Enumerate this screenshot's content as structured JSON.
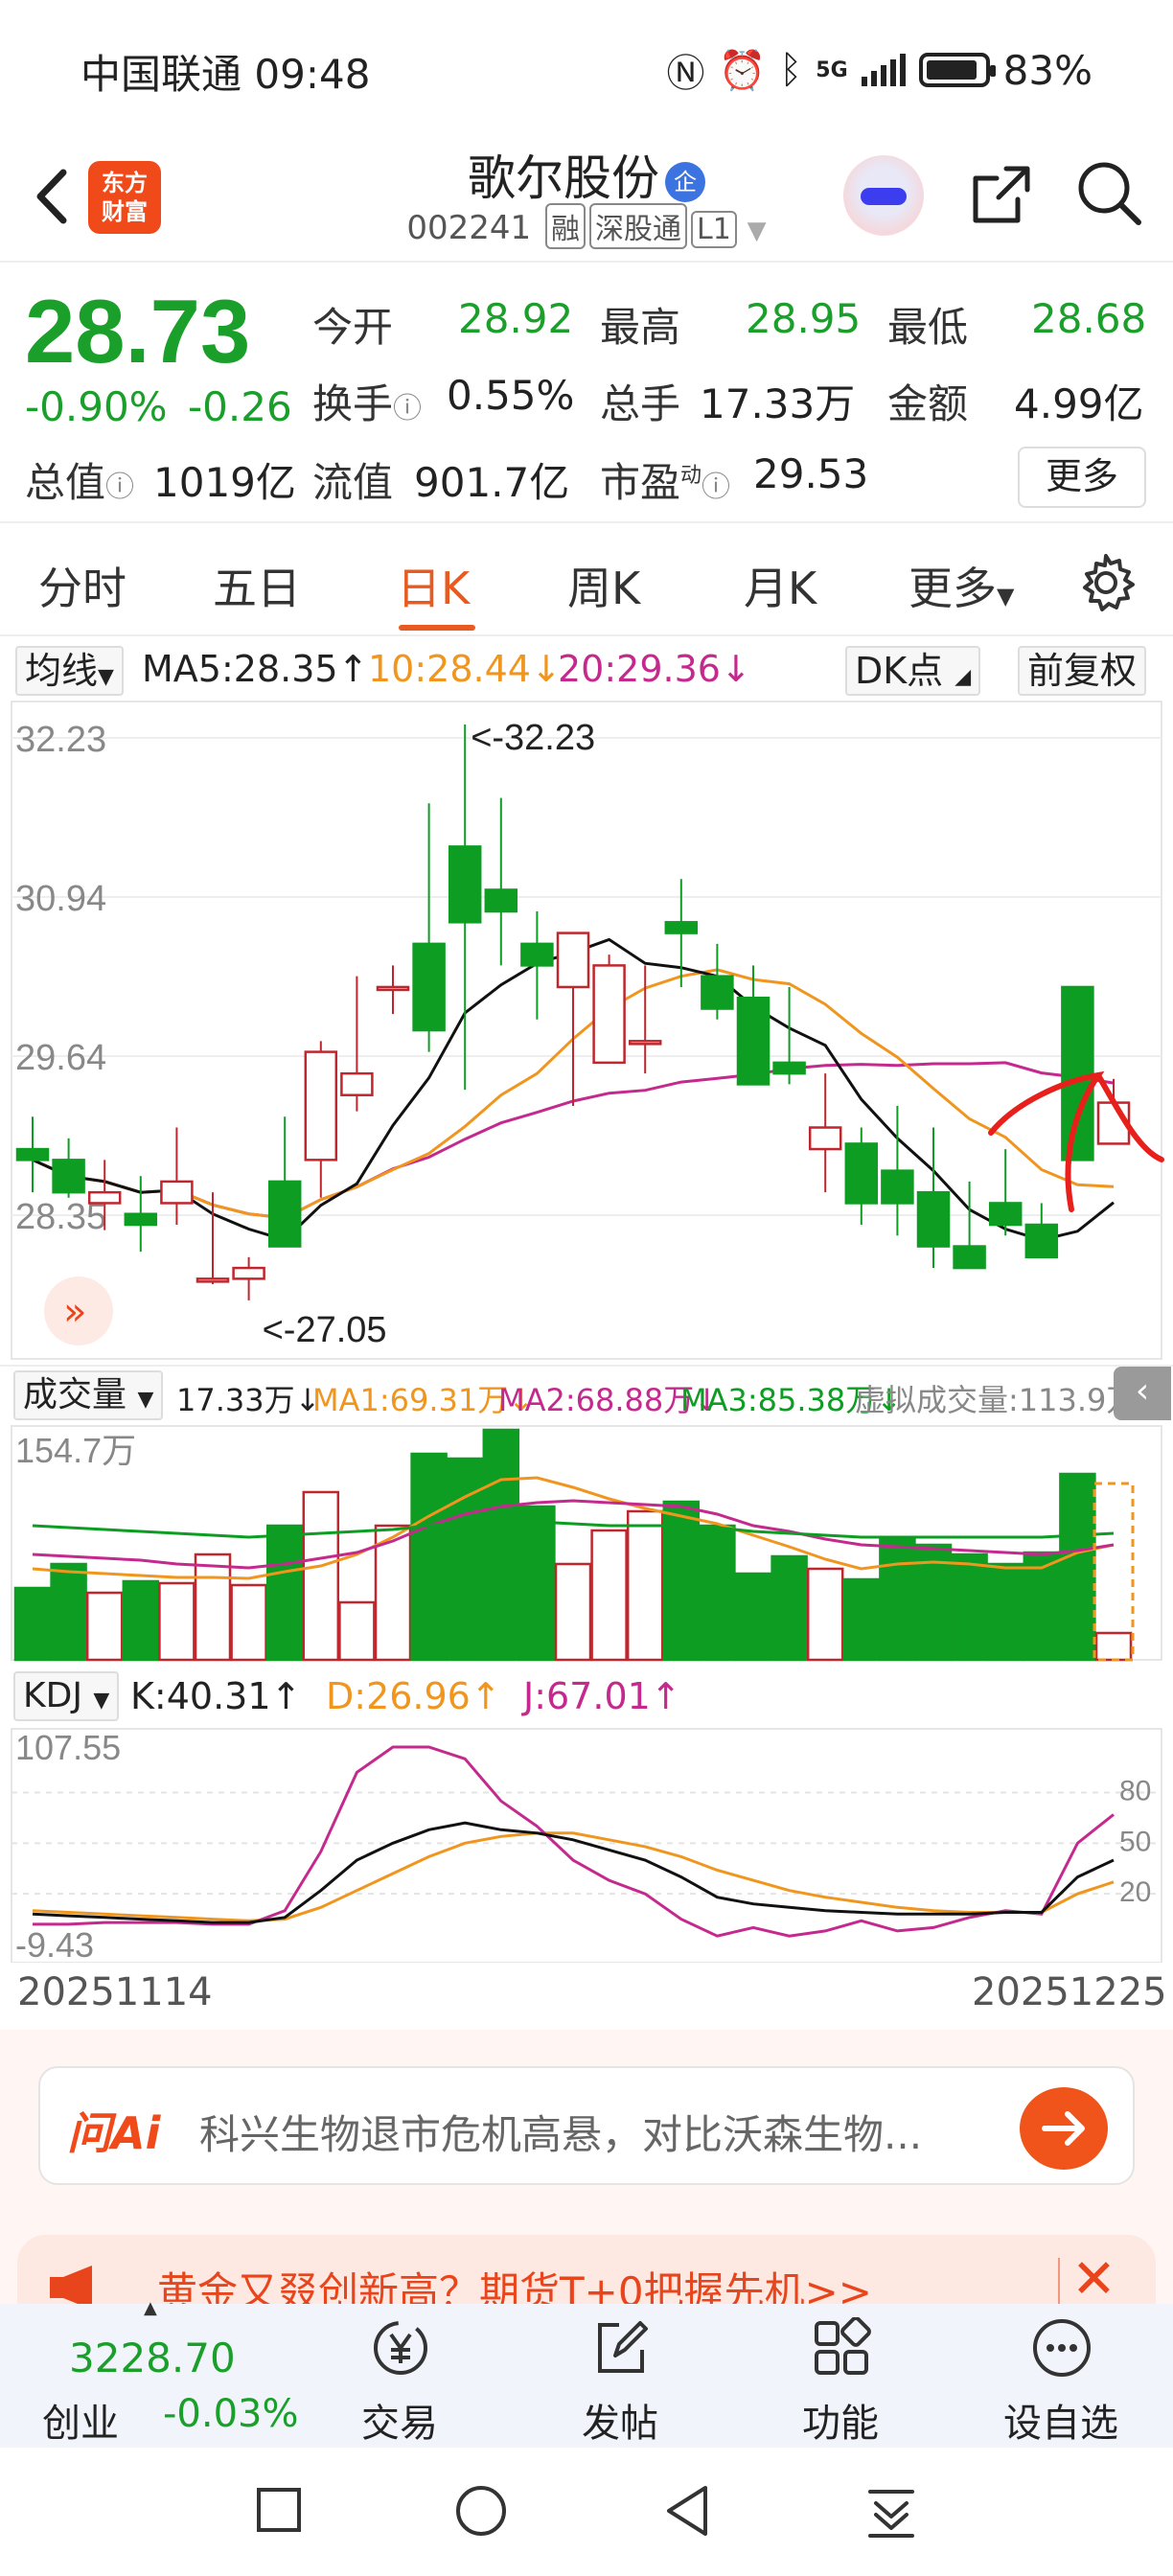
{
  "status_bar": {
    "carrier": "中国联通",
    "time": "09:48",
    "battery": "83%",
    "network": "5G"
  },
  "header": {
    "logo_text_line1": "东方",
    "logo_text_line2": "财富",
    "stock_name": "歌尔股份",
    "stock_badge": "企",
    "stock_code": "002241",
    "tag_margin": "融",
    "tag_connect": "深股通",
    "tag_level": "L1"
  },
  "quote": {
    "price": "28.73",
    "change_pct": "-0.90%",
    "change": "-0.26",
    "open_label": "今开",
    "open": "28.92",
    "high_label": "最高",
    "high": "28.95",
    "low_label": "最低",
    "low": "28.68",
    "turnover_label": "换手",
    "turnover": "0.55%",
    "volume_label": "总手",
    "volume": "17.33万",
    "amount_label": "金额",
    "amount": "4.99亿",
    "mcap_label": "总值",
    "mcap": "1019亿",
    "float_label": "流值",
    "float": "901.7亿",
    "pe_label": "市盈",
    "pe_sup": "动",
    "pe": "29.53",
    "more_label": "更多"
  },
  "tabs": [
    {
      "label": "分时"
    },
    {
      "label": "五日"
    },
    {
      "label": "日K",
      "active": true
    },
    {
      "label": "周K"
    },
    {
      "label": "月K"
    },
    {
      "label": "更多"
    }
  ],
  "ma_row": {
    "selector": "均线",
    "ma5": "MA5:28.35",
    "ma10": "10:28.44",
    "ma20": "20:29.36",
    "dk": "DK点",
    "adjust": "前复权"
  },
  "kline": {
    "y_labels": [
      "32.23",
      "30.94",
      "29.64",
      "28.35",
      "27.05"
    ],
    "max_note": "<-32.23",
    "min_note": "<-27.05",
    "colors": {
      "up": "#c0262d",
      "down": "#0e9d23",
      "ma5": "#111111",
      "ma10": "#f0961e",
      "ma20": "#c42a8e"
    }
  },
  "chart_data": {
    "type": "candlestick",
    "x_start": "20251114",
    "x_end": "20251225",
    "ohlc": [
      [
        28.3,
        28.6,
        27.9,
        28.2
      ],
      [
        28.2,
        28.4,
        27.85,
        27.9
      ],
      [
        27.8,
        28.2,
        27.55,
        27.9
      ],
      [
        27.7,
        28.05,
        27.35,
        27.6
      ],
      [
        27.8,
        28.5,
        27.6,
        28.0
      ],
      [
        27.1,
        27.9,
        27.05,
        27.1
      ],
      [
        27.1,
        27.3,
        26.9,
        27.2
      ],
      [
        28.0,
        28.6,
        27.65,
        27.4
      ],
      [
        28.2,
        29.3,
        27.85,
        29.2
      ],
      [
        28.8,
        29.9,
        28.65,
        29.0
      ],
      [
        29.8,
        30.0,
        29.55,
        29.8
      ],
      [
        30.2,
        31.5,
        29.2,
        29.4
      ],
      [
        31.1,
        32.23,
        28.85,
        30.4
      ],
      [
        30.7,
        31.55,
        30.0,
        30.5
      ],
      [
        30.2,
        30.5,
        29.5,
        30.0
      ],
      [
        29.8,
        30.3,
        28.7,
        30.3
      ],
      [
        29.1,
        30.1,
        29.8,
        30.0
      ],
      [
        29.3,
        30.0,
        29.0,
        29.3
      ],
      [
        30.4,
        30.8,
        29.8,
        30.3
      ],
      [
        29.9,
        30.2,
        29.5,
        29.6
      ],
      [
        29.7,
        30.0,
        28.9,
        28.9
      ],
      [
        29.1,
        29.8,
        28.9,
        29.0
      ],
      [
        28.3,
        29.0,
        27.9,
        28.5
      ],
      [
        28.35,
        28.5,
        27.6,
        27.8
      ],
      [
        28.1,
        28.7,
        27.5,
        27.8
      ],
      [
        27.9,
        28.5,
        27.2,
        27.4
      ],
      [
        27.4,
        28.0,
        27.2,
        27.2
      ],
      [
        27.8,
        28.3,
        27.5,
        27.6
      ],
      [
        27.6,
        27.8,
        27.4,
        27.3
      ],
      [
        29.8,
        29.4,
        28.4,
        28.2
      ],
      [
        28.35,
        28.95,
        28.68,
        28.73
      ]
    ],
    "volume_label": "成交量",
    "volume": "17.33万",
    "vol_ma1": "MA1:69.31万",
    "vol_ma2": "MA2:68.88万",
    "vol_ma3": "MA3:85.38万",
    "virtual_volume": "虚拟成交量:113.9万",
    "vol_max": "154.7万",
    "kdj_label": "KDJ",
    "k": "K:40.31",
    "d": "D:26.96",
    "j": "J:67.01",
    "kdj_y_top": "107.55",
    "kdj_y_bottom": "-9.43",
    "kdj_levels": [
      "80",
      "50",
      "20"
    ]
  },
  "ask_ai": {
    "logo": "问Ai",
    "placeholder": "科兴生物退市危机高悬，对比沃森生物..."
  },
  "banner": {
    "text": "黄金又叕创新高？期货T+0把握先机>>"
  },
  "bottom_tabs": {
    "index_value": "3228.70",
    "index_name": "创业",
    "index_change": "-0.03%",
    "trade": "交易",
    "post": "发帖",
    "function": "功能",
    "watchlist": "设自选"
  }
}
